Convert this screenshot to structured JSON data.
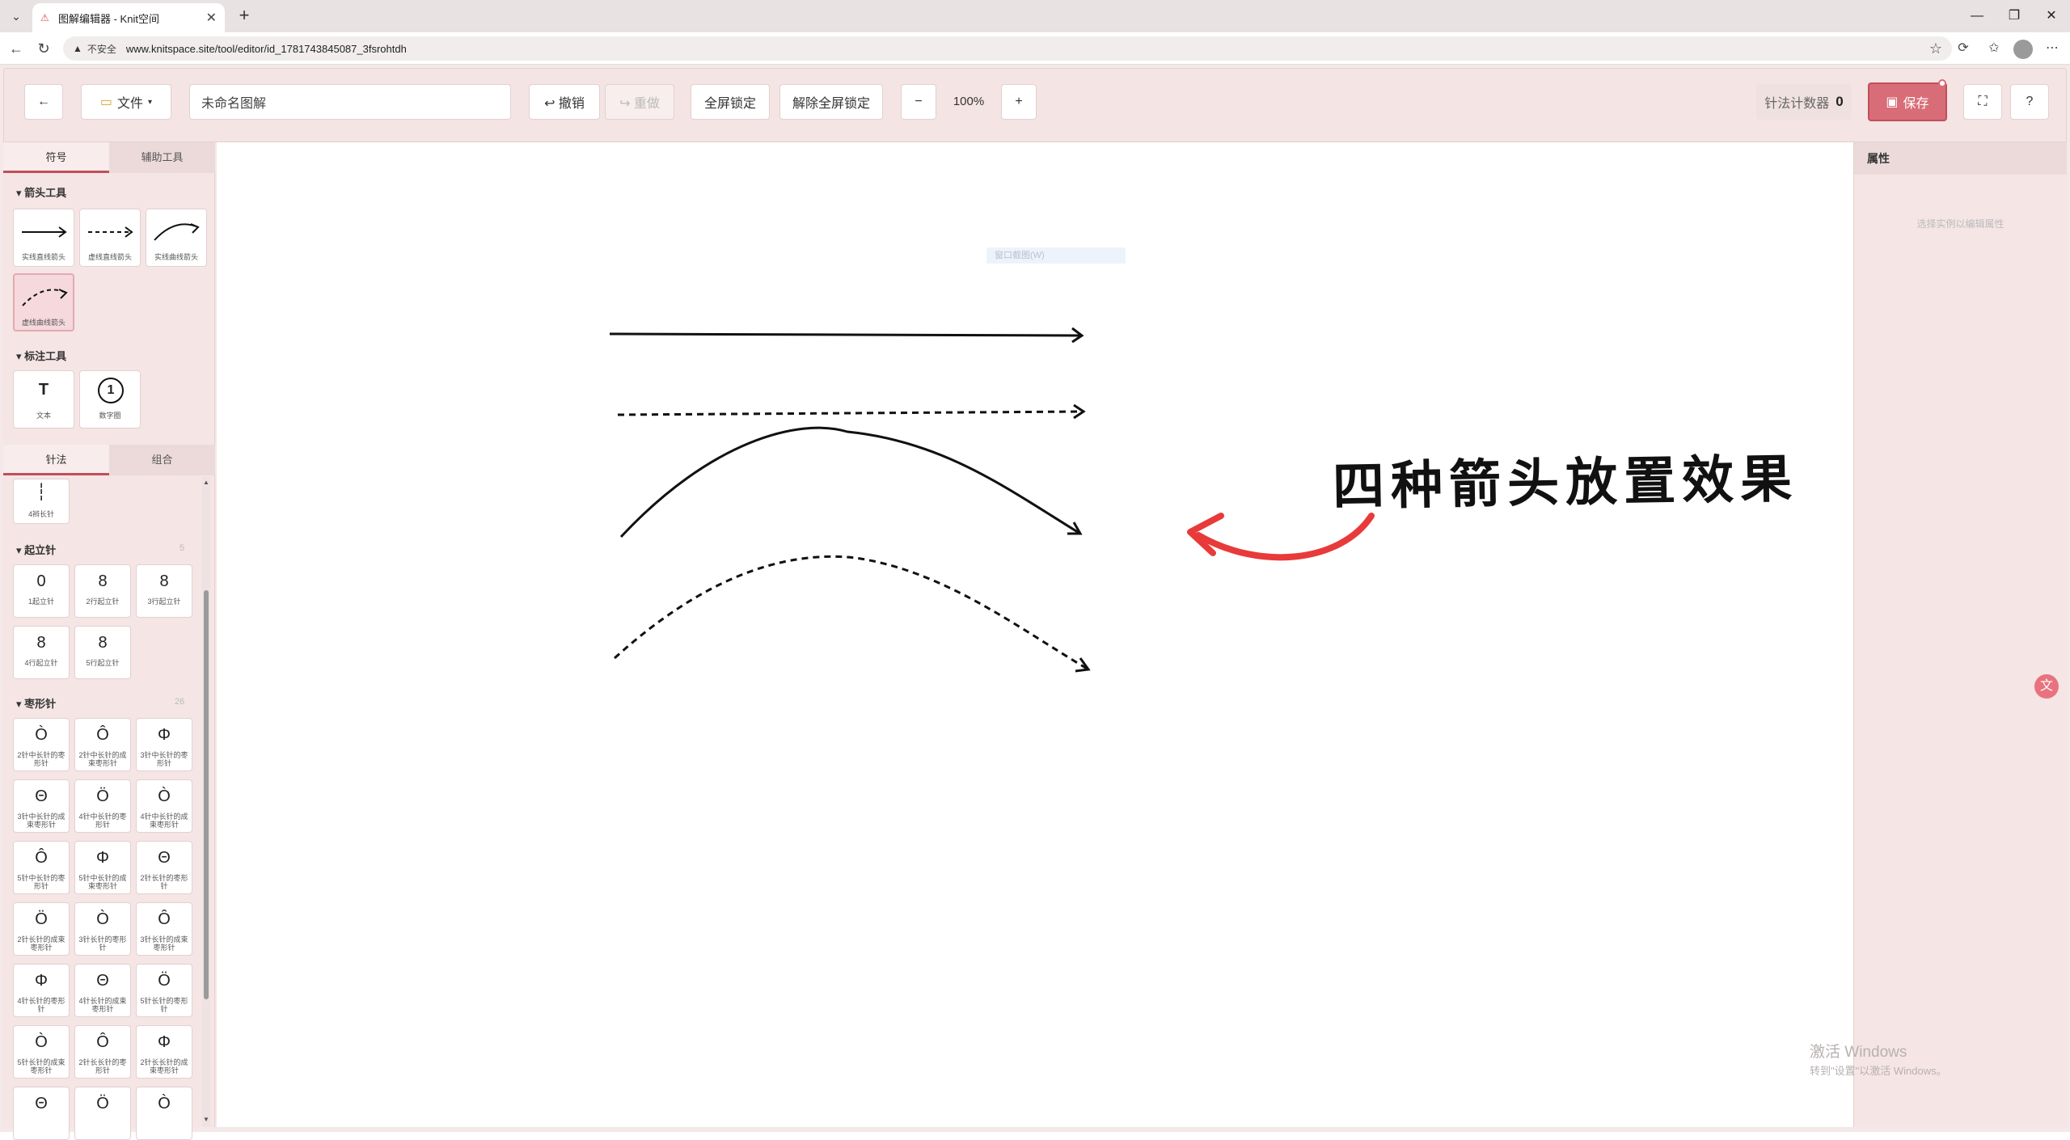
{
  "browser": {
    "tab_title": "图解编辑器 - Knit空间",
    "insecure_label": "不安全",
    "url": "www.knitspace.site/tool/editor/id_1781743845087_3fsrohtdh"
  },
  "toolbar": {
    "back": "←",
    "file_label": "文件",
    "title_placeholder": "未命名图解",
    "undo_label": "↩ 撤销",
    "redo_label": "↪ 重做",
    "lock_all_label": "全屏锁定",
    "unlock_all_label": "解除全屏锁定",
    "zoom_out": "−",
    "zoom_level": "100%",
    "zoom_in": "+",
    "counter_label": "针法计数器",
    "counter_value": "0",
    "save_label": "保存",
    "fullscreen": "⛶",
    "help": "?"
  },
  "left_panel": {
    "tabs_top": [
      "符号",
      "辅助工具"
    ],
    "arrow_section": "箭头工具",
    "arrow_tools": [
      "实线直线箭头",
      "虚线直线箭头",
      "实线曲线箭头",
      "虚线曲线箭头"
    ],
    "annot_section": "标注工具",
    "annot_tools": [
      "文本",
      "数字圈"
    ],
    "tabs_bottom": [
      "针法",
      "组合"
    ],
    "partial_item": "4辫长针",
    "chain_section": "起立针",
    "chain_count": "5",
    "chain_items": [
      "1起立针",
      "2行起立针",
      "3行起立针",
      "4行起立针",
      "5行起立针"
    ],
    "cluster_section": "枣形针",
    "cluster_count": "26",
    "cluster_items": [
      "2针中长针的枣形针",
      "2针中长针的成束枣形针",
      "3针中长针的枣形针",
      "3针中长针的成束枣形针",
      "4针中长针的枣形针",
      "4针中长针的成束枣形针",
      "5针中长针的枣形针",
      "5针中长针的成束枣形针",
      "2针长针的枣形针",
      "2针长针的成束枣形针",
      "3针长针的枣形针",
      "3针长针的成束枣形针",
      "4针长针的枣形针",
      "4针长针的成束枣形针",
      "5针长针的枣形针",
      "5针长针的成束枣形针",
      "2针长长针的枣形针",
      "2针长长针的成束枣形针",
      "",
      "",
      ""
    ]
  },
  "canvas": {
    "hint": "窗口截图(W)",
    "annotation": "四种箭头放置效果"
  },
  "right_panel": {
    "title": "属性",
    "empty_hint": "选择实例以编辑属性"
  },
  "watermark": {
    "line1": "激活 Windows",
    "line2": "转到\"设置\"以激活 Windows。"
  }
}
